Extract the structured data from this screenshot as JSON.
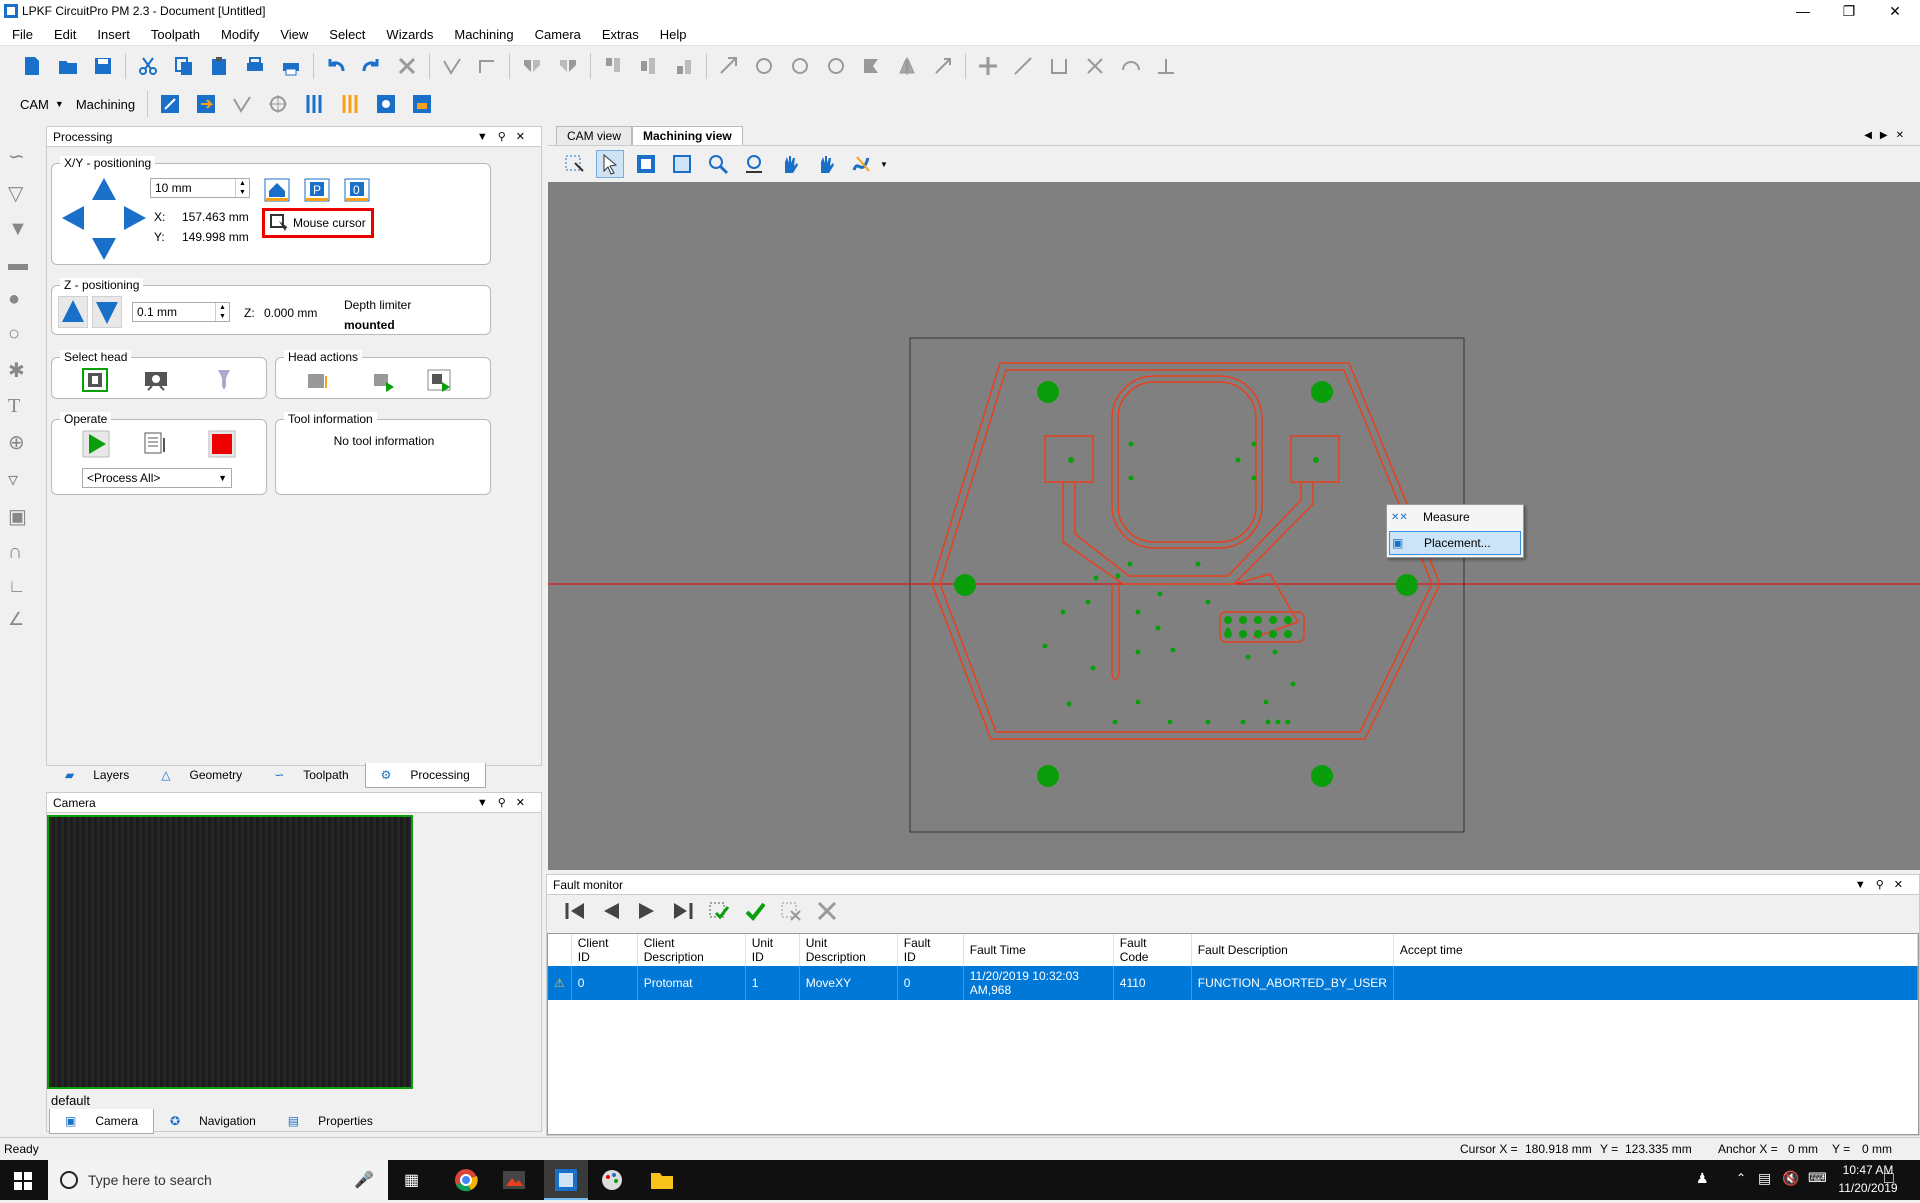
{
  "window": {
    "title": "LPKF CircuitPro PM 2.3 - Document [Untitled]"
  },
  "menu": [
    "File",
    "Edit",
    "Insert",
    "Toolpath",
    "Modify",
    "View",
    "Select",
    "Wizards",
    "Machining",
    "Camera",
    "Extras",
    "Help"
  ],
  "toolbar2": {
    "mode": "CAM",
    "machining": "Machining"
  },
  "processing": {
    "title": "Processing",
    "xy": {
      "label": "X/Y - positioning",
      "step": "10 mm",
      "x_label": "X:",
      "x_value": "157.463 mm",
      "y_label": "Y:",
      "y_value": "149.998 mm",
      "mouse_cursor": "Mouse cursor"
    },
    "z": {
      "label": "Z - positioning",
      "step": "0.1 mm",
      "z_label": "Z:",
      "z_value": "0.000 mm",
      "depth_limiter": "Depth limiter",
      "depth_status": "mounted"
    },
    "select_head": "Select head",
    "head_actions": "Head actions",
    "operate": "Operate",
    "process_select": "<Process All>",
    "tool_info": {
      "label": "Tool information",
      "text": "No tool information"
    }
  },
  "left_tabs": [
    "Layers",
    "Geometry",
    "Toolpath",
    "Processing"
  ],
  "camera": {
    "title": "Camera",
    "profile": "default"
  },
  "camera_tabs": [
    "Camera",
    "Navigation",
    "Properties"
  ],
  "views": {
    "tabs": [
      "CAM view",
      "Machining view"
    ],
    "active": "Machining view"
  },
  "context_menu": {
    "items": [
      "Measure",
      "Placement..."
    ]
  },
  "fault_monitor": {
    "title": "Fault monitor",
    "columns": [
      [
        "Client",
        "ID"
      ],
      [
        "Client",
        "Description"
      ],
      [
        "Unit",
        "ID"
      ],
      [
        "Unit",
        "Description"
      ],
      [
        "Fault",
        "ID"
      ],
      [
        "Fault Time",
        ""
      ],
      [
        "Fault",
        "Code"
      ],
      [
        "Fault Description",
        ""
      ],
      [
        "Accept time",
        ""
      ]
    ],
    "rows": [
      [
        "0",
        "Protomat",
        "1",
        "MoveXY",
        "0",
        "11/20/2019 10:32:03 AM,968",
        "4110",
        "FUNCTION_ABORTED_BY_USER",
        ""
      ]
    ]
  },
  "status": {
    "ready": "Ready",
    "cursor_x_label": "Cursor X =",
    "cursor_x": "180.918 mm",
    "cursor_y_label": "Y =",
    "cursor_y": "123.335 mm",
    "anchor_x_label": "Anchor X =",
    "anchor_x": "0 mm",
    "anchor_y_label": "Y =",
    "anchor_y": "0 mm"
  },
  "taskbar": {
    "search_placeholder": "Type here to search",
    "time": "10:47 AM",
    "date": "11/20/2019"
  },
  "colors": {
    "accent": "#0078d7",
    "trace": "#e8401c",
    "pad": "#0a9e0a",
    "canvas": "#808080"
  }
}
